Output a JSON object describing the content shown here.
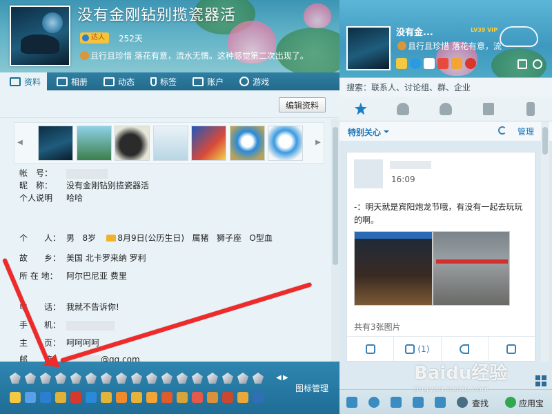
{
  "profile": {
    "nickname": "没有金刚钻别揽瓷器活",
    "vip_badge": "达人",
    "days": "252天",
    "signature": "且行且珍惜 落花有意，流水无情。这种感觉第二次出现了。"
  },
  "left_tabs": [
    {
      "label": "资料"
    },
    {
      "label": "相册"
    },
    {
      "label": "动态"
    },
    {
      "label": "标签"
    },
    {
      "label": "账户"
    },
    {
      "label": "游戏"
    }
  ],
  "toolbar": {
    "edit_label": "编辑资料"
  },
  "info": {
    "account_key": "帐　号：",
    "nickname_key": "昵　称：",
    "nickname_value": "没有金刚钻别揽瓷器活",
    "desc_key": "个人说明",
    "desc_value": "哈哈",
    "personal_key": "个　　人：",
    "personal_gender": "男",
    "personal_age": "8岁",
    "personal_birthday": "8月9日(公历生日)",
    "personal_zodiac": "属猪",
    "personal_sign": "狮子座",
    "personal_blood": "O型血",
    "hometown_key": "故　　乡：",
    "hometown_value": "美国 北卡罗来纳 罗利",
    "location_key": "所 在 地：",
    "location_value": "阿尔巴尼亚 费里",
    "phone_key": "电　　话：",
    "phone_value": "我就不告诉你!",
    "mobile_key": "手　　机：",
    "homepage_key": "主　　页：",
    "homepage_value": "呵呵呵呵",
    "email_key": "邮　　箱：",
    "email_value": "@qq.com"
  },
  "icon_panel": {
    "manage_label": "图标管理"
  },
  "right": {
    "name": "没有金...",
    "level": "LV39 VIP",
    "signature": "且行且珍惜 落花有意，流",
    "search_placeholder": "搜索：联系人、讨论组、群、企业",
    "special_label": "特别关心",
    "manage_label": "管理",
    "feed_time": "16:09",
    "feed_text": "-：明天就是宾阳炮龙节哦，有没有一起去玩玩的啊。",
    "feed_count": "共有3张图片",
    "comment_count": "(1)",
    "find_label": "查找",
    "appbox_label": "应用宝"
  },
  "watermark": {
    "brand": "Baidu经验",
    "url": "jingyan.baidu.com"
  },
  "colors": {
    "accent": "#1a74b8",
    "tab_bar": "#2f7fa3",
    "arrow": "#ef2a2a",
    "banner": "#5fb1c6"
  }
}
